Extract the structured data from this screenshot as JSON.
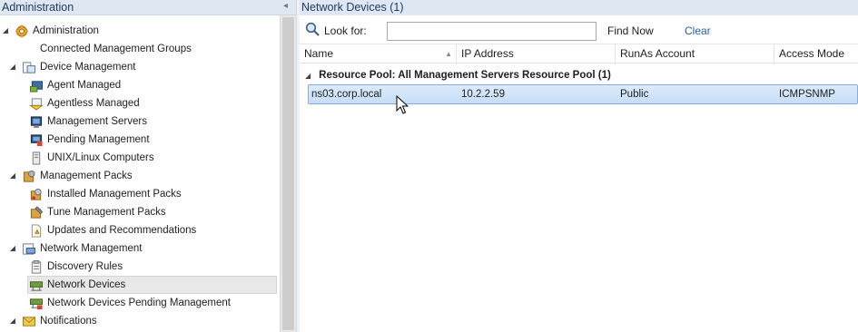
{
  "left_pane": {
    "title": "Administration",
    "collapse_glyph": "◂",
    "tree": [
      {
        "label": "Administration",
        "expanded": true,
        "icon": "gear-icon"
      },
      {
        "label": "Connected Management Groups",
        "icon": "none"
      },
      {
        "label": "Device Management",
        "expanded": true,
        "icon": "device-management-icon"
      },
      {
        "label": "Agent Managed",
        "icon": "agent-managed-icon"
      },
      {
        "label": "Agentless Managed",
        "icon": "agentless-managed-icon"
      },
      {
        "label": "Management Servers",
        "icon": "management-servers-icon"
      },
      {
        "label": "Pending Management",
        "icon": "pending-management-icon"
      },
      {
        "label": "UNIX/Linux Computers",
        "icon": "unix-linux-computers-icon"
      },
      {
        "label": "Management Packs",
        "expanded": true,
        "icon": "management-packs-icon"
      },
      {
        "label": "Installed Management Packs",
        "icon": "installed-management-packs-icon"
      },
      {
        "label": "Tune Management Packs",
        "icon": "tune-management-packs-icon"
      },
      {
        "label": "Updates and Recommendations",
        "icon": "updates-recommendations-icon"
      },
      {
        "label": "Network Management",
        "expanded": true,
        "icon": "network-management-icon"
      },
      {
        "label": "Discovery Rules",
        "icon": "discovery-rules-icon"
      },
      {
        "label": "Network Devices",
        "selected": true,
        "icon": "network-devices-icon"
      },
      {
        "label": "Network Devices Pending Management",
        "icon": "network-devices-pending-icon"
      },
      {
        "label": "Notifications",
        "expanded": true,
        "icon": "notifications-icon"
      }
    ]
  },
  "right_pane": {
    "title": "Network Devices (1)",
    "search": {
      "look_for_label": "Look for:",
      "value": "",
      "placeholder": "",
      "find_now_label": "Find Now",
      "clear_label": "Clear"
    },
    "columns": [
      "Name",
      "IP Address",
      "RunAs Account",
      "Access Mode"
    ],
    "sort_glyph": "▲",
    "group": {
      "expand_glyph": "◢",
      "label": "Resource Pool: All Management Servers Resource Pool (1)"
    },
    "rows": [
      {
        "name": "ns03.corp.local",
        "ip_address": "10.2.2.59",
        "runas_account": "Public",
        "access_mode": "ICMPSNMP"
      }
    ]
  },
  "colors": {
    "header_bg": "#dee7f2",
    "selection_bg": "#c6ddf7",
    "selection_border": "#84acdd",
    "link": "#1f5fa8"
  }
}
